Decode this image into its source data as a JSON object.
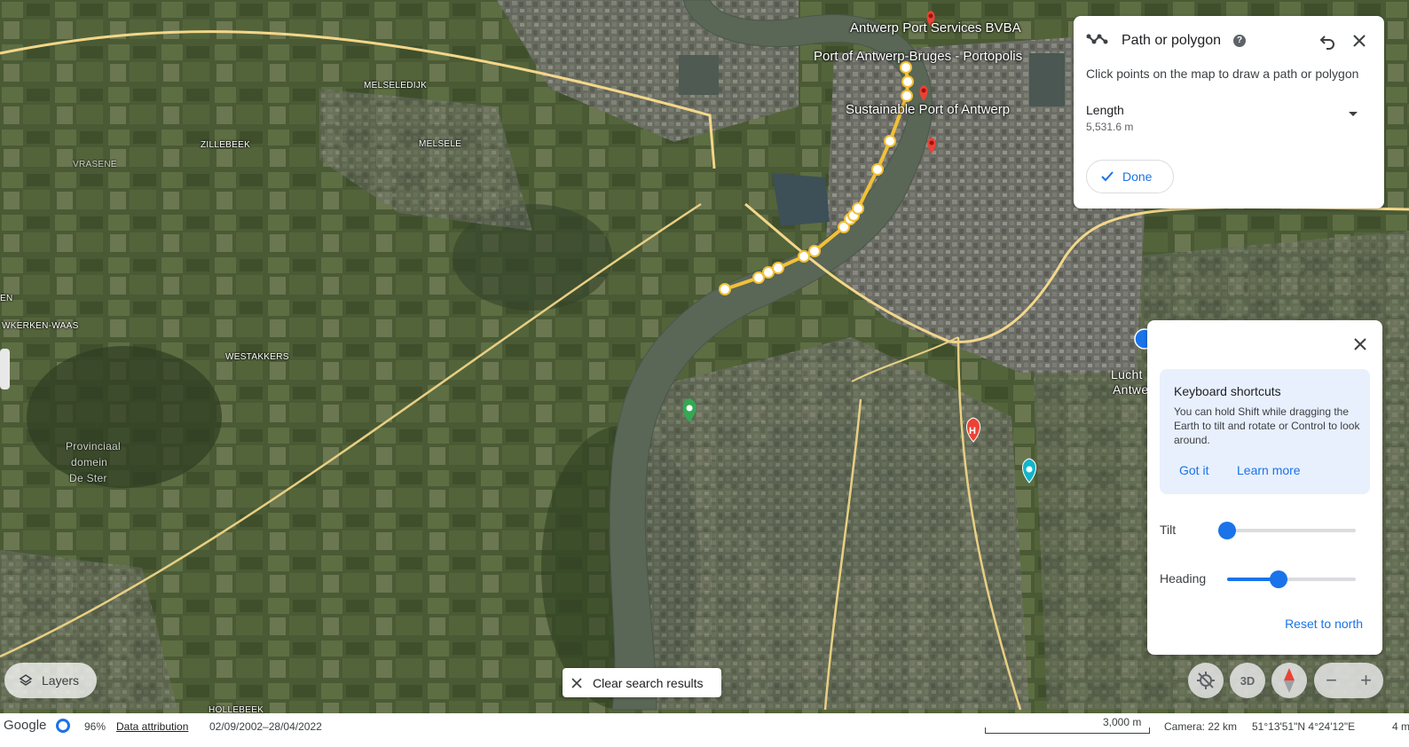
{
  "map": {
    "place_labels": [
      {
        "id": "melseledijk",
        "text": "MELSELEDIJK"
      },
      {
        "id": "zillebeek",
        "text": "ZILLEBEEK"
      },
      {
        "id": "melsele",
        "text": "MELSELE"
      },
      {
        "id": "vrasene",
        "text": "VRASENE"
      },
      {
        "id": "wkerken",
        "text": "WKERKEN-WAAS"
      },
      {
        "id": "en",
        "text": "EN"
      },
      {
        "id": "westakkers",
        "text": "WESTAKKERS"
      },
      {
        "id": "hollebeek",
        "text": "HOLLEBEEK"
      },
      {
        "id": "provinciaal1",
        "text": "Provinciaal"
      },
      {
        "id": "provinciaal2",
        "text": "domein"
      },
      {
        "id": "provinciaal3",
        "text": "De Ster"
      },
      {
        "id": "lucht1",
        "text": "Lucht"
      },
      {
        "id": "lucht2",
        "text": "Antwe"
      }
    ],
    "poi_labels": [
      {
        "id": "port-services",
        "text": "Antwerp Port Services BVBA"
      },
      {
        "id": "portopolis",
        "text": "Port of Antwerp-Bruges - Portopolis"
      },
      {
        "id": "sustainable",
        "text": "Sustainable Port of Antwerp"
      }
    ]
  },
  "path_panel": {
    "title": "Path or polygon",
    "help": "?",
    "hint": "Click points on the map to draw a path or polygon",
    "length_label": "Length",
    "length_value": "5,531.6 m",
    "done_label": "Done"
  },
  "nav_panel": {
    "shortcuts_title": "Keyboard shortcuts",
    "shortcuts_body": "You can hold Shift while dragging the Earth to tilt and rotate or Control to look around.",
    "got_it": "Got it",
    "learn_more": "Learn more",
    "tilt_label": "Tilt",
    "tilt_value": 0,
    "heading_label": "Heading",
    "heading_value": 0.4,
    "reset_north": "Reset to north"
  },
  "controls": {
    "layers_label": "Layers",
    "clear_search_label": "Clear search results",
    "three_d_label": "3D",
    "zoom_out": "−",
    "zoom_in": "+"
  },
  "bottom_bar": {
    "brand": "Google",
    "load_percent": "96%",
    "data_attribution": "Data attribution",
    "date_range": "02/09/2002–28/04/2022",
    "scale_label": "3,000 m",
    "camera": "Camera: 22 km",
    "coordinates": "51°13'51\"N 4°24'12\"E",
    "elevation": "4 m"
  },
  "colors": {
    "accent": "#1a73e8",
    "path": "#f2c037",
    "marker_red": "#ea4335",
    "marker_green": "#34a853"
  }
}
